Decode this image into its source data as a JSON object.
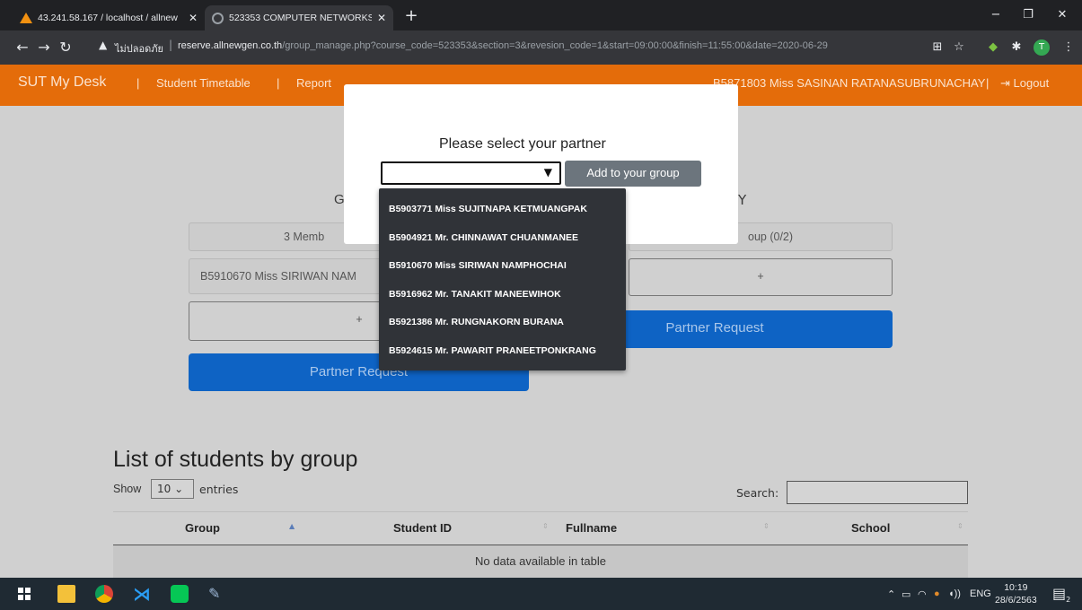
{
  "browser": {
    "tabs": [
      {
        "label": "43.241.58.167 / localhost / allnew",
        "active": false
      },
      {
        "label": "523353 COMPUTER NETWORKS",
        "active": true
      }
    ],
    "new_tab": "+",
    "window_controls": {
      "minimize": "−",
      "maximize": "❐",
      "close": "✕"
    },
    "address": {
      "warning_icon": "warning-icon",
      "not_secure": "ไม่ปลอดภัย",
      "host": "reserve.allnewgen.co.th",
      "path": "/group_manage.php?course_code=523353&section=3&revesion_code=1&start=09:00:00&finish=11:55:00&date=2020-06-29"
    },
    "profile_initial": "T"
  },
  "site_nav": {
    "brand": "SUT My Desk",
    "sep": "|",
    "items": [
      "Student Timetable",
      "Report"
    ],
    "user": "B5871803 Miss SASINAN RATANASUBRUNACHAY",
    "logout": "Logout",
    "accent": "#e46c0a"
  },
  "groups": {
    "left_heading": "G",
    "right_heading": "Y",
    "left_members": "3 Memb",
    "left_member_1": "B5910670 Miss SIRIWAN NAM",
    "plus": "+",
    "right_count": "oup (0/2)",
    "partner_request": "Partner Request"
  },
  "list": {
    "title": "List of students by group",
    "show": "Show",
    "page_size": "10",
    "entries": "entries",
    "search": "Search:",
    "columns": [
      "Group",
      "Student ID",
      "Fullname",
      "School"
    ],
    "empty": "No data available in table"
  },
  "modal": {
    "title": "Please select your partner",
    "select_value": "",
    "add_button": "Add to your group",
    "options": [
      "B5903771 Miss SUJITNAPA KETMUANGPAK",
      "B5904921 Mr. CHINNAWAT CHUANMANEE",
      "B5910670 Miss SIRIWAN NAMPHOCHAI",
      "B5916962 Mr. TANAKIT MANEEWIHOK",
      "B5921386 Mr. RUNGNAKORN BURANA",
      "B5924615 Mr. PAWARIT PRANEETPONKRANG"
    ]
  },
  "taskbar": {
    "tray_lang": "ENG",
    "time": "10:19",
    "date": "28/6/2563",
    "notification_count": "2"
  }
}
